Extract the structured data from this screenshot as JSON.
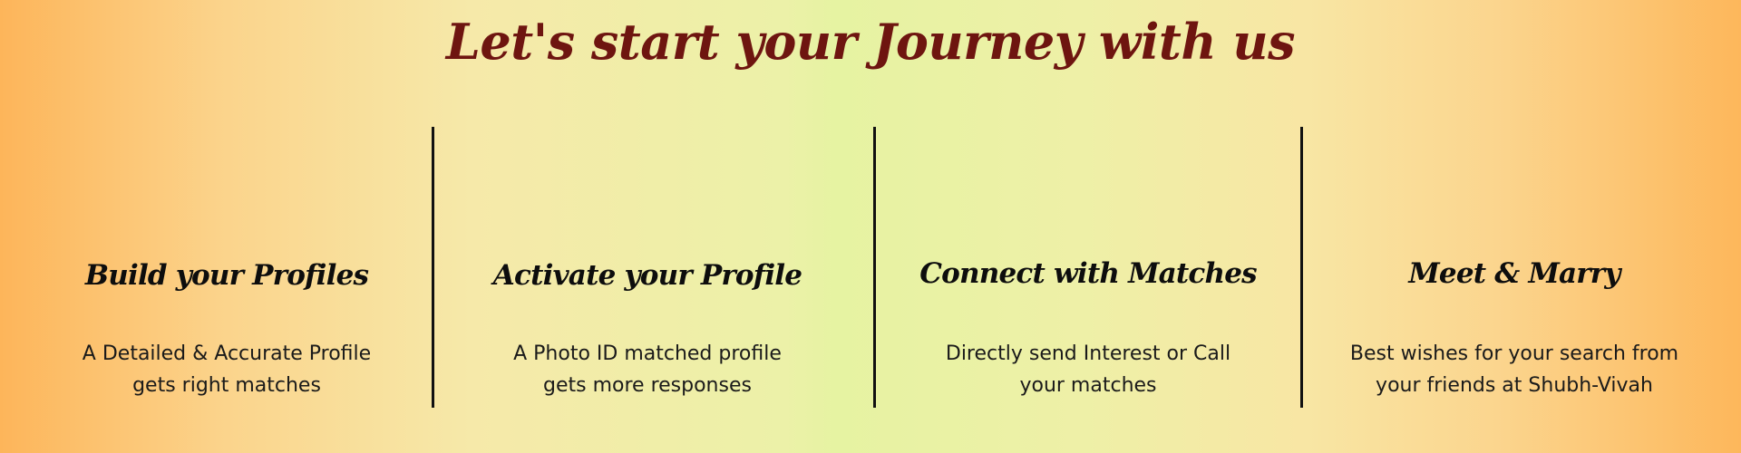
{
  "header": {
    "title": "Let's start your Journey with us"
  },
  "steps": [
    {
      "title": "Build your Profiles",
      "description": "A Detailed & Accurate Profile gets right matches"
    },
    {
      "title": "Activate your Profile",
      "description": "A Photo ID matched profile gets more responses"
    },
    {
      "title": "Connect with Matches",
      "description": "Directly send Interest or Call your matches"
    },
    {
      "title": "Meet & Marry",
      "description": "Best wishes for your search from your friends at Shubh-Vivah"
    }
  ],
  "colors": {
    "title": "#6e1510",
    "text": "#0d0d0d",
    "gradient_edge": "#fdb55a",
    "gradient_center": "#e6f3a2"
  }
}
